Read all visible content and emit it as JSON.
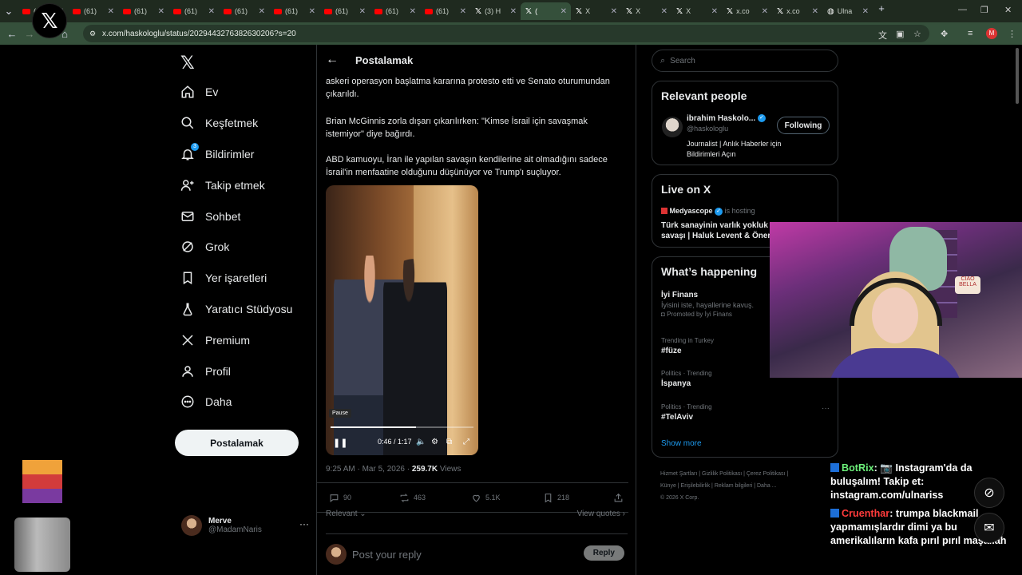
{
  "browser": {
    "tabs": [
      {
        "icon": "youtube",
        "label": "(61) Y"
      },
      {
        "icon": "youtube",
        "label": "(61)"
      },
      {
        "icon": "youtube",
        "label": "(61)"
      },
      {
        "icon": "youtube",
        "label": "(61)"
      },
      {
        "icon": "youtube",
        "label": "(61)"
      },
      {
        "icon": "youtube",
        "label": "(61)"
      },
      {
        "icon": "youtube",
        "label": "(61)"
      },
      {
        "icon": "youtube",
        "label": "(61)"
      },
      {
        "icon": "youtube",
        "label": "(61)"
      },
      {
        "icon": "x",
        "label": "(3) H"
      },
      {
        "icon": "x",
        "label": "(",
        "active": true
      },
      {
        "icon": "x",
        "label": "X"
      },
      {
        "icon": "x",
        "label": "X"
      },
      {
        "icon": "x",
        "label": "X"
      },
      {
        "icon": "x",
        "label": "x.co"
      },
      {
        "icon": "x",
        "label": "x.co"
      },
      {
        "icon": "globe",
        "label": "Ulna"
      }
    ],
    "url": "x.com/haskologlu/status/2029443276382630206?s=20"
  },
  "nav": {
    "items": [
      {
        "label": "Ev",
        "icon": "home-icon"
      },
      {
        "label": "Keşfetmek",
        "icon": "search-icon"
      },
      {
        "label": "Bildirimler",
        "icon": "bell-icon",
        "badge": "3"
      },
      {
        "label": "Takip etmek",
        "icon": "add-user-icon"
      },
      {
        "label": "Sohbet",
        "icon": "mail-icon"
      },
      {
        "label": "Grok",
        "icon": "grok-icon"
      },
      {
        "label": "Yer işaretleri",
        "icon": "bookmark-icon"
      },
      {
        "label": "Yaratıcı Stüdyosu",
        "icon": "flask-icon"
      },
      {
        "label": "Premium",
        "icon": "x-icon"
      },
      {
        "label": "Profil",
        "icon": "person-icon"
      },
      {
        "label": "Daha",
        "icon": "more-circle-icon"
      }
    ],
    "post_label": "Postalamak",
    "user": {
      "name": "Merve",
      "handle": "@MadamNaris",
      "more": "···"
    }
  },
  "main": {
    "header_title": "Postalamak",
    "paragraphs": [
      "askeri operasyon başlatma kararına protesto etti ve Senato oturumundan çıkarıldı.",
      "Brian McGinnis zorla dışarı çıkarılırken: \"Kimse İsrail için savaşmak istemiyor\" diye bağırdı.",
      "ABD kamuoyu, İran ile yapılan savaşın kendilerine ait olmadığını sadece İsrail'in menfaatine olduğunu düşünüyor ve Trump'ı suçluyor."
    ],
    "video": {
      "tooltip": "Pause",
      "time": "0:46 / 1:17",
      "progress": 0.6
    }
  },
  "post_meta": {
    "time": "9:25 AM · Mar 5, 2026 · ",
    "views_count": "259.7K",
    "views_label": " Views"
  },
  "actions": {
    "replies": "90",
    "reposts": "463",
    "likes": "5.1K",
    "bookmarks": "218"
  },
  "replies": {
    "sort": "Relevant",
    "view_quotes": "View quotes",
    "placeholder": "Post your reply",
    "reply_button": "Reply"
  },
  "right": {
    "search_placeholder": "Search",
    "relevant": {
      "title": "Relevant people",
      "name": "ibrahim Haskolo...",
      "handle": "@haskologlu",
      "bio": "Journalist | Anlık Haberler için Bildirimleri Açın",
      "follow_label": "Following"
    },
    "live": {
      "title": "Live on X",
      "host": "Medyascope",
      "hosting": "is hosting",
      "topic": "Türk sanayinin varlık yokluk savaşı | Haluk Levent & Öner"
    },
    "happening": {
      "title": "What’s happening",
      "promo_name": "İyi Finans",
      "promo_text": "İyisini iste, hayallerine kavuş.",
      "promo_by": "Promoted by İyi Finans",
      "trends": [
        {
          "meta": "Trending in Turkey",
          "name": "#füze"
        },
        {
          "meta": "Politics · Trending",
          "name": "İspanya"
        },
        {
          "meta": "Politics · Trending",
          "name": "#TelAviv"
        }
      ],
      "show_more": "Show more",
      "more": "···"
    },
    "footer": {
      "line1": "Hizmet Şartları  |  Gizlilik Politikası  |  Çerez Politikası  |",
      "line2": "Künye  |  Erişilebilirlik  |  Reklam bilgileri  |  Daha ...",
      "line3": "© 2026 X Corp."
    }
  },
  "stream": {
    "plush_sign": "CIAO BELLA",
    "chat": [
      {
        "name": "BotRix",
        "message": "📷 Instagram'da da buluşalım! Takip et: instagram.com/ulnariss"
      },
      {
        "name": "Cruenthar",
        "message": "trumpa blackmail yapmamışlardır dimi ya bu amerikalıların kafa pırıl pırıl maşallah"
      }
    ]
  }
}
